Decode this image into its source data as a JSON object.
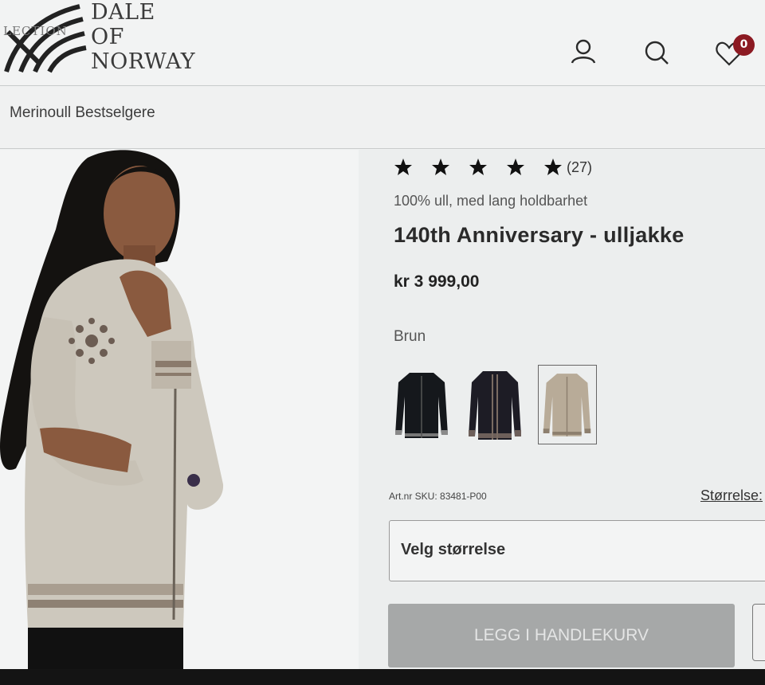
{
  "brand": {
    "name_lines": [
      "DALE",
      "OF",
      "NORWAY"
    ],
    "side_text": "LECTION"
  },
  "header": {
    "icons": [
      "user-icon",
      "search-icon",
      "heart-icon"
    ],
    "wishlist_count": "0"
  },
  "breadcrumb": {
    "label": "Merinoull Bestselgere"
  },
  "product": {
    "rating_stars": 5,
    "review_count": "(27)",
    "tagline": "100% ull, med lang holdbarhet",
    "title": "140th Anniversary - ulljakke",
    "price": "kr 3 999,00",
    "color_label": "Brun",
    "sku": "Art.nr SKU: 83481-P00",
    "size_guide": "Størrelse:",
    "size_select_placeholder": "Velg størrelse",
    "add_to_cart": "LEGG I HANDLEKURV"
  },
  "colors": {
    "accent": "#8c1a22",
    "button_disabled": "#a6a8a8"
  }
}
